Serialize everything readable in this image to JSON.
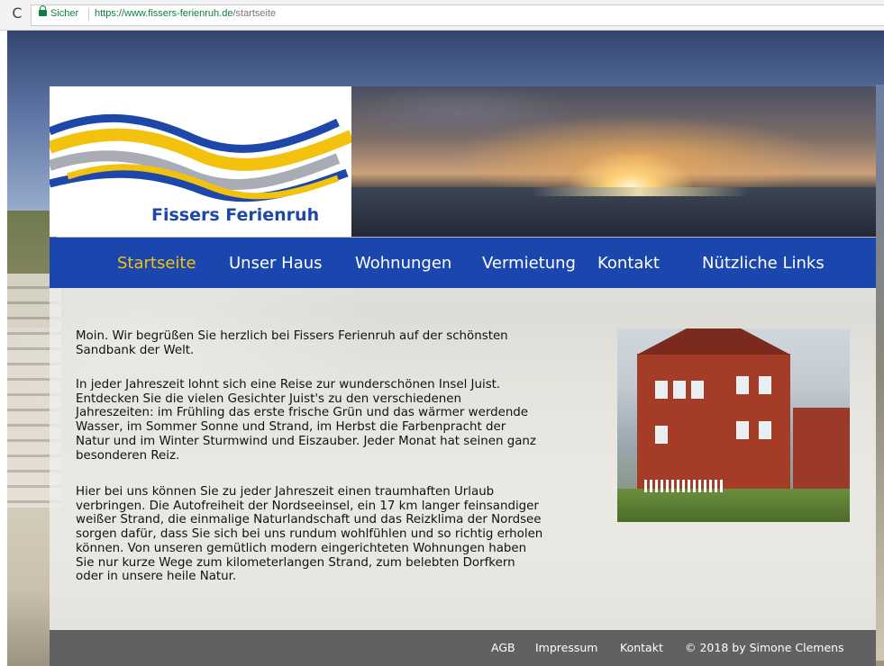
{
  "browser": {
    "reload_glyph": "C",
    "secure_label": "Sicher",
    "url_host": "https://www.fissers-ferienruh.de",
    "url_path": "/startseite"
  },
  "site": {
    "logo_text": "Fissers Ferienruh",
    "brand_colors": {
      "blue": "#1a46ae",
      "yellow": "#f3c20f",
      "grey": "#a9acb5"
    }
  },
  "nav": {
    "items": [
      {
        "label": "Startseite",
        "active": true
      },
      {
        "label": "Unser Haus",
        "active": false
      },
      {
        "label": "Wohnungen",
        "active": false
      },
      {
        "label": "Vermietung",
        "active": false
      },
      {
        "label": "Kontakt",
        "active": false
      },
      {
        "label": "Nützliche Links",
        "active": false
      }
    ]
  },
  "content": {
    "paragraphs": [
      "Moin. Wir begrüßen Sie herzlich bei Fissers Ferienruh auf der schönsten\nSandbank der Welt.",
      "In jeder Jahreszeit lohnt sich eine Reise zur wunderschönen Insel Juist.\nEntdecken Sie die vielen Gesichter Juist's zu den verschiedenen\nJahreszeiten: im Frühling das erste frische Grün und das wärmer werdende\nWasser, im Sommer Sonne und Strand, im Herbst die Farbenpracht der\nNatur und im Winter Sturmwind und Eiszauber. Jeder Monat hat seinen ganz\nbesonderen Reiz.",
      "Hier bei uns können Sie zu jeder Jahreszeit einen traumhaften Urlaub\nverbringen. Die Autofreiheit der Nordseeinsel, ein 17 km langer feinsandiger\nweißer Strand, die einmalige Naturlandschaft und das Reizklima der Nordsee\nsorgen dafür, dass Sie sich bei uns rundum wohlfühlen und so richtig erholen\nkönnen. Von unseren gemütlich modern eingerichteten Wohnungen haben\nSie nur kurze Wege zum kilometerlangen Strand, zum belebten Dorfkern\noder in unsere heile Natur."
    ]
  },
  "footer": {
    "links": [
      "AGB",
      "Impressum",
      "Kontakt"
    ],
    "copyright": "© 2018 by Simone Clemens"
  }
}
